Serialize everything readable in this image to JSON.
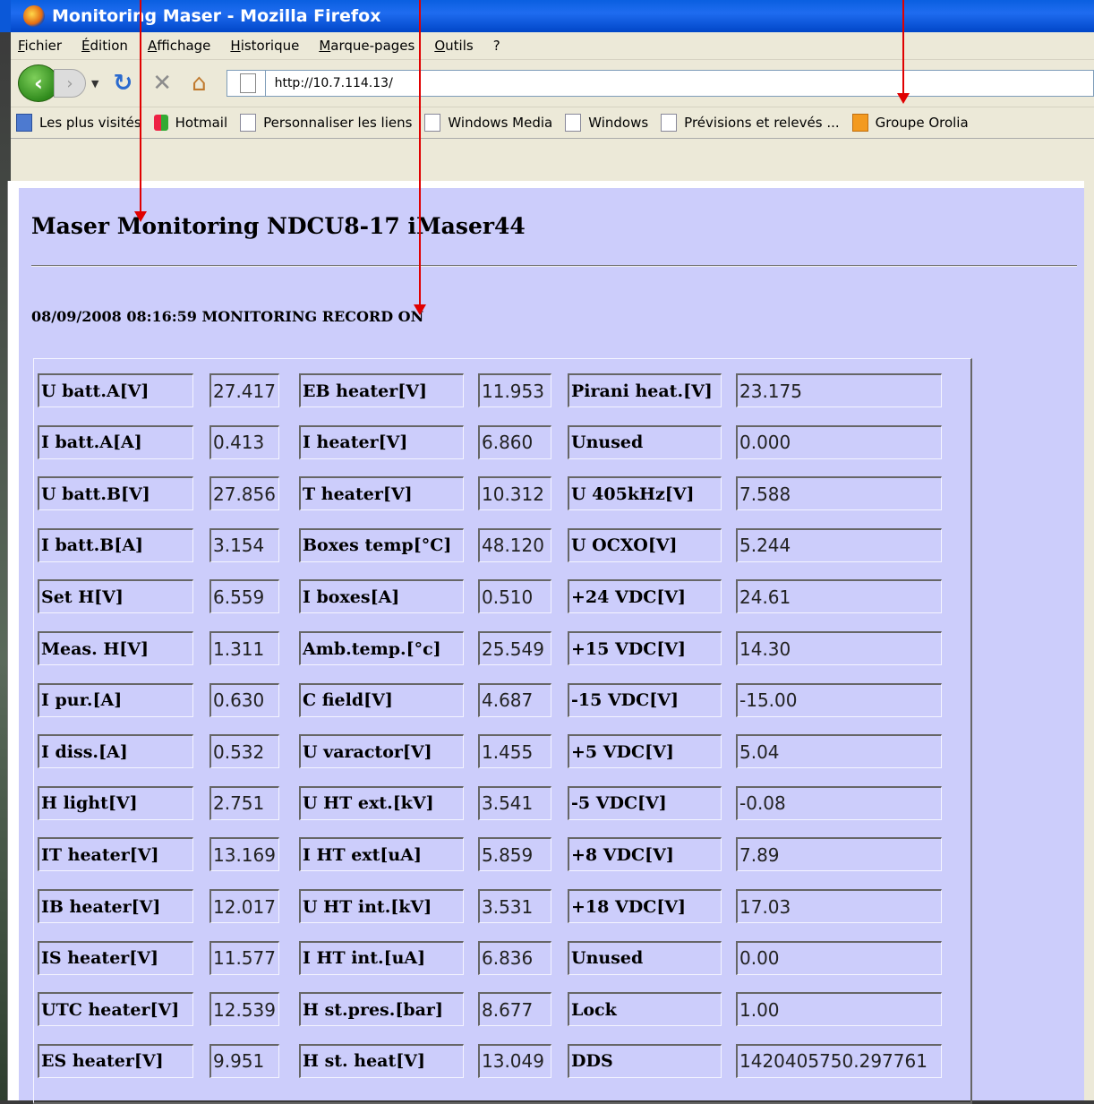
{
  "window": {
    "title": "Monitoring Maser - Mozilla Firefox"
  },
  "menu": [
    "Fichier",
    "Édition",
    "Affichage",
    "Historique",
    "Marque-pages",
    "Outils",
    "?"
  ],
  "nav": {
    "url": "http://10.7.114.13/"
  },
  "bookmarks": [
    {
      "label": "Les plus visités",
      "icon": "blue"
    },
    {
      "label": "Hotmail",
      "icon": "ms"
    },
    {
      "label": "Personnaliser les liens",
      "icon": "page"
    },
    {
      "label": "Windows Media",
      "icon": "page"
    },
    {
      "label": "Windows",
      "icon": "page"
    },
    {
      "label": "Prévisions et relevés ...",
      "icon": "page"
    },
    {
      "label": "Groupe Orolia",
      "icon": "rss"
    }
  ],
  "page": {
    "heading": "Maser Monitoring NDCU8-17 iMaser44",
    "status": "08/09/2008 08:16:59 MONITORING RECORD ON",
    "rows": [
      [
        [
          "U batt.A[V]",
          "27.417"
        ],
        [
          "EB heater[V]",
          "11.953"
        ],
        [
          "Pirani heat.[V]",
          "23.175"
        ]
      ],
      [
        [
          "I batt.A[A]",
          "0.413"
        ],
        [
          "I heater[V]",
          "6.860"
        ],
        [
          "Unused",
          "0.000"
        ]
      ],
      [
        [
          "U batt.B[V]",
          "27.856"
        ],
        [
          "T heater[V]",
          "10.312"
        ],
        [
          "U 405kHz[V]",
          "7.588"
        ]
      ],
      [
        [
          "I batt.B[A]",
          "3.154"
        ],
        [
          "Boxes temp[°C]",
          "48.120"
        ],
        [
          "U OCXO[V]",
          "5.244"
        ]
      ],
      [
        [
          "Set H[V]",
          "6.559"
        ],
        [
          "I boxes[A]",
          "0.510"
        ],
        [
          "+24 VDC[V]",
          "24.61"
        ]
      ],
      [
        [
          "Meas. H[V]",
          "1.311"
        ],
        [
          "Amb.temp.[°c]",
          "25.549"
        ],
        [
          "+15 VDC[V]",
          "14.30"
        ]
      ],
      [
        [
          "I pur.[A]",
          "0.630"
        ],
        [
          "C field[V]",
          "4.687"
        ],
        [
          "-15 VDC[V]",
          "-15.00"
        ]
      ],
      [
        [
          "I diss.[A]",
          "0.532"
        ],
        [
          "U varactor[V]",
          "1.455"
        ],
        [
          "+5 VDC[V]",
          "5.04"
        ]
      ],
      [
        [
          "H light[V]",
          "2.751"
        ],
        [
          "U HT ext.[kV]",
          "3.541"
        ],
        [
          "-5 VDC[V]",
          "-0.08"
        ]
      ],
      [
        [
          "IT heater[V]",
          "13.169"
        ],
        [
          "I HT ext[uA]",
          "5.859"
        ],
        [
          "+8 VDC[V]",
          "7.89"
        ]
      ],
      [
        [
          "IB heater[V]",
          "12.017"
        ],
        [
          "U HT int.[kV]",
          "3.531"
        ],
        [
          "+18 VDC[V]",
          "17.03"
        ]
      ],
      [
        [
          "IS heater[V]",
          "11.577"
        ],
        [
          "I HT int.[uA]",
          "6.836"
        ],
        [
          "Unused",
          "0.00"
        ]
      ],
      [
        [
          "UTC heater[V]",
          "12.539"
        ],
        [
          "H st.pres.[bar]",
          "8.677"
        ],
        [
          "Lock",
          "1.00"
        ]
      ],
      [
        [
          "ES heater[V]",
          "9.951"
        ],
        [
          "H st. heat[V]",
          "13.049"
        ],
        [
          "DDS",
          "1420405750.297761"
        ]
      ]
    ]
  }
}
